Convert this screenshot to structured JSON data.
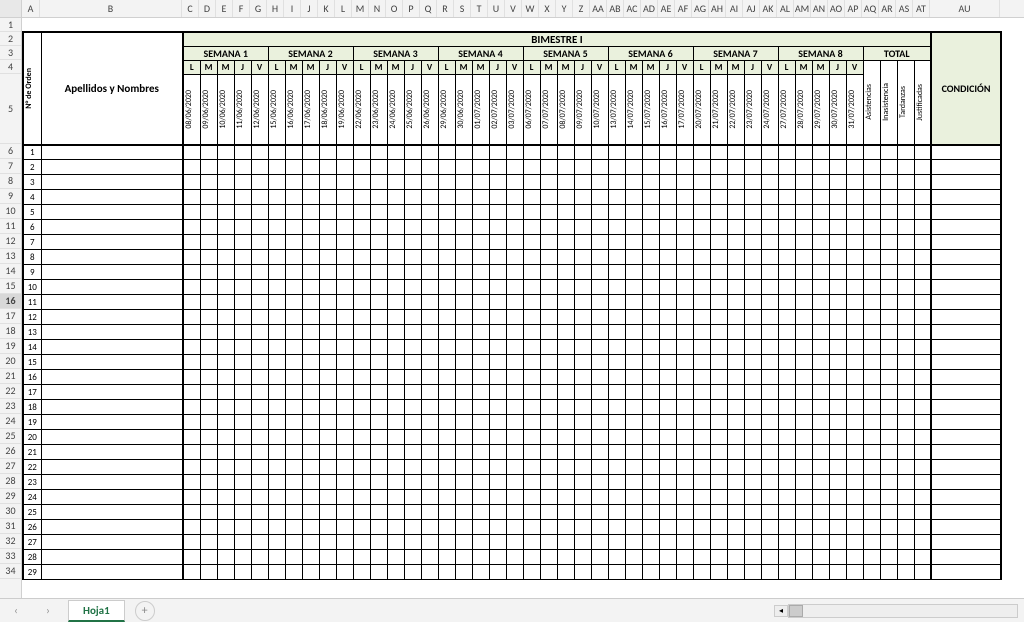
{
  "sheet_tab": "Hoja1",
  "columns": {
    "A_label": "A",
    "B_label": "B",
    "AU_label": "AU",
    "letters": [
      "C",
      "D",
      "E",
      "F",
      "G",
      "H",
      "I",
      "J",
      "K",
      "L",
      "M",
      "N",
      "O",
      "P",
      "Q",
      "R",
      "S",
      "T",
      "U",
      "V",
      "W",
      "X",
      "Y",
      "Z",
      "AA",
      "AB",
      "AC",
      "AD",
      "AE",
      "AF",
      "AG",
      "AH",
      "AI",
      "AJ",
      "AK",
      "AL",
      "AM",
      "AN",
      "AO",
      "AP",
      "AQ",
      "AR",
      "AS",
      "AT"
    ]
  },
  "row_numbers": [
    1,
    2,
    3,
    4,
    5,
    6,
    7,
    8,
    9,
    10,
    11,
    12,
    13,
    14,
    15,
    16,
    17,
    18,
    19,
    20,
    21,
    22,
    23,
    24,
    25,
    26,
    27,
    28,
    29,
    30,
    31,
    32,
    33,
    34
  ],
  "selected_row": 16,
  "header": {
    "orden": "N° de Orden",
    "names": "Apellidos y Nombres",
    "bimestre": "BIMESTRE I",
    "weeks": [
      "SEMANA 1",
      "SEMANA 2",
      "SEMANA 3",
      "SEMANA 4",
      "SEMANA 5",
      "SEMANA 6",
      "SEMANA 7",
      "SEMANA 8"
    ],
    "days": [
      "L",
      "M",
      "M",
      "J",
      "V"
    ],
    "total": "TOTAL",
    "totals_sub": [
      "Asistencias",
      "Inasistencia",
      "Tardanzas",
      "Justificadas"
    ],
    "condicion": "CONDICIÓN"
  },
  "dates": [
    "08/06/2020",
    "09/06/2020",
    "10/06/2020",
    "11/06/2020",
    "12/06/2020",
    "15/06/2020",
    "16/06/2020",
    "17/06/2020",
    "18/06/2020",
    "19/06/2020",
    "22/06/2020",
    "23/06/2020",
    "24/06/2020",
    "25/06/2020",
    "26/06/2020",
    "29/06/2020",
    "30/06/2020",
    "01/07/2020",
    "02/07/2020",
    "03/07/2020",
    "06/07/2020",
    "07/07/2020",
    "08/07/2020",
    "09/07/2020",
    "10/07/2020",
    "13/07/2020",
    "14/07/2020",
    "15/07/2020",
    "16/07/2020",
    "17/07/2020",
    "20/07/2020",
    "21/07/2020",
    "22/07/2020",
    "23/07/2020",
    "24/07/2020",
    "27/07/2020",
    "28/07/2020",
    "29/07/2020",
    "30/07/2020",
    "31/07/2020"
  ],
  "data_rows": 29,
  "nav": {
    "first": "◂",
    "prev": "‹",
    "next": "›",
    "last": "▸",
    "add": "+"
  }
}
